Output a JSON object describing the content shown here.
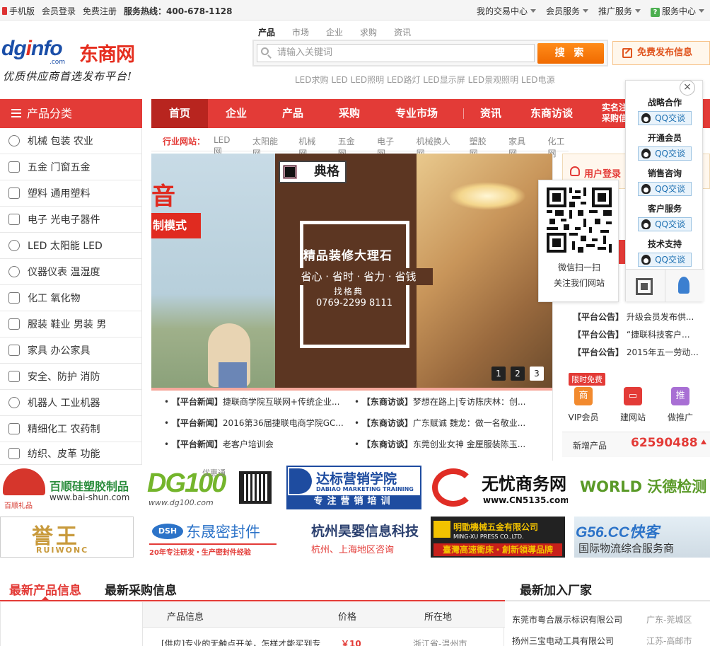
{
  "topbar": {
    "mobile": "手机版",
    "login": "会员登录",
    "register": "免费注册",
    "hotline": "服务热线：400-678-1128",
    "trade_center": "我的交易中心",
    "member_service": "会员服务",
    "promo_service": "推广服务",
    "service_center": "服务中心"
  },
  "logo": {
    "en": "dginfo",
    "cn": "东商网",
    "com": ".com",
    "slogan": "优质供应商首选发布平台!"
  },
  "search": {
    "tabs": [
      "产品",
      "市场",
      "企业",
      "求购",
      "资讯"
    ],
    "placeholder": "请输入关键词",
    "button": "搜 索",
    "publish": "免费发布信息",
    "hotwords": "LED求购 LED LED照明 LED路灯 LED显示屏 LED景观照明 LED电源"
  },
  "category_header": "产品分类",
  "categories": [
    {
      "label": "机械  包装  农业",
      "icon": "gear-icon"
    },
    {
      "label": "五金  门窗五金",
      "icon": "hardware-icon"
    },
    {
      "label": "塑料  通用塑料",
      "icon": "sliders-icon"
    },
    {
      "label": "电子  光电子器件",
      "icon": "tv-icon"
    },
    {
      "label": "LED  太阳能  LED",
      "icon": "bulb-icon"
    },
    {
      "label": "仪器仪表  温湿度",
      "icon": "gauge-icon"
    },
    {
      "label": "化工  氧化物",
      "icon": "flask-icon"
    },
    {
      "label": "服装  鞋业  男装  男",
      "icon": "shirt-icon"
    },
    {
      "label": "家具  办公家具",
      "icon": "sofa-icon"
    },
    {
      "label": "安全、防护  消防",
      "icon": "monitor-icon"
    },
    {
      "label": "机器人  工业机器",
      "icon": "robot-icon"
    },
    {
      "label": "精细化工  农药制",
      "icon": "gift-icon"
    },
    {
      "label": "纺织、皮革  功能",
      "icon": "bag-icon"
    }
  ],
  "nav": {
    "items": [
      "首页",
      "企业",
      "产品",
      "采购",
      "专业市场",
      "资讯",
      "东商访谈"
    ],
    "extra": "实名注\n采购信"
  },
  "industry": {
    "label": "行业网站：",
    "links": [
      "LED网",
      "太阳能网",
      "机械网",
      "五金网",
      "电子网",
      "机械换人网",
      "塑胶网",
      "家具网",
      "化工网"
    ]
  },
  "banner": {
    "red_big": "音",
    "red_tag": "制模式",
    "brand": "典格",
    "slogan1": "精品装修大理石",
    "slogan2": "省心 · 省时 · 省力 · 省钱",
    "find": "找格典",
    "tel": "0769-2299 8111",
    "pages": [
      "1",
      "2",
      "3"
    ],
    "active_page": 3
  },
  "news": [
    {
      "tag": "【平台新闻】",
      "title": "捷联商学院互联网+传统企业..."
    },
    {
      "tag": "【东商访谈】",
      "title": "梦想在路上|专访陈庆林：创..."
    },
    {
      "tag": "【平台新闻】",
      "title": "2016第36届捷联电商学院GC..."
    },
    {
      "tag": "【东商访谈】",
      "title": "广东赋诚 魏龙：做一名敬业..."
    },
    {
      "tag": "【平台新闻】",
      "title": "老客户培训会"
    },
    {
      "tag": "【东商访谈】",
      "title": "东莞创业女神 金厘服装陈玉..."
    }
  ],
  "sidebar": {
    "login": "用户登录",
    "notices": [
      {
        "tag": "【平台公告】",
        "title": "升级会员发布供..."
      },
      {
        "tag": "【平台公告】",
        "title": "“捷联科技客户..."
      },
      {
        "tag": "【平台公告】",
        "title": "2015年五一劳动..."
      }
    ],
    "limit_free": "限时免费",
    "services": [
      {
        "label": "VIP会员",
        "icon": "shop-icon",
        "glyph": "商",
        "color": "#f28a2e"
      },
      {
        "label": "建网站",
        "icon": "laptop-icon",
        "glyph": "▭",
        "color": "#e33b37"
      },
      {
        "label": "做推广",
        "icon": "promote-icon",
        "glyph": "推",
        "color": "#a86fd4"
      }
    ],
    "new_products_label": "新增产品",
    "new_products_count": "62590488"
  },
  "qr_popup": {
    "line1": "微信扫一扫",
    "line2": "关注我们网站"
  },
  "qq_panel": {
    "close": "×",
    "groups": [
      {
        "title": "战略合作",
        "button": "QQ交谈"
      },
      {
        "title": "开通会员",
        "button": "QQ交谈"
      },
      {
        "title": "销售咨询",
        "button": "QQ交谈"
      },
      {
        "title": "客户服务",
        "button": "QQ交谈"
      },
      {
        "title": "技术支持",
        "button": "QQ交谈"
      }
    ]
  },
  "ads": [
    {
      "name": "ad-baishun",
      "text": "百顺硅塑胶制品",
      "sub": "www.bai-shun.com",
      "sub2": "百顺礼品"
    },
    {
      "name": "ad-dg100",
      "text": "DG100",
      "sub": "www.dg100.com",
      "badge": "优惠通"
    },
    {
      "name": "ad-dabiao",
      "text": "达标营销学院",
      "sub": "DABIAO MARKETING TRAINING",
      "sub2": "专注营销培训"
    },
    {
      "name": "ad-cn5135",
      "text": "无忧商务网",
      "sub": "www.CN5135.com"
    },
    {
      "name": "ad-world",
      "text": "WORLD 沃德检测"
    },
    {
      "name": "ad-yuwang",
      "text": "誉王",
      "sub": "RUIWONC"
    },
    {
      "name": "ad-dsh",
      "text": "东晟密封件",
      "sub": "20年专注研发・生产密封件经验",
      "badge": "DSH"
    },
    {
      "name": "ad-haoying",
      "text": "杭州昊婴信息科技",
      "sub": "杭州、上海地区咨询"
    },
    {
      "name": "ad-mingxu",
      "text": "明勖機械五金有限公司",
      "sub": "MING-XU PRESS CO.,LTD.",
      "sub2": "臺灣高速衝床・創新領導品牌"
    },
    {
      "name": "ad-g56",
      "text": "G56.CC快客",
      "sub": "国际物流综合服务商"
    }
  ],
  "bottom": {
    "tabs": [
      "最新产品信息",
      "最新采购信息"
    ],
    "factory_title": "最新加入厂家",
    "table_headers": [
      "产品信息",
      "价格",
      "所在地"
    ],
    "row": {
      "title": "[供应]专业的无触点开关，怎样才能买到专",
      "price": "￥10",
      "location": "浙江省-温州市"
    },
    "factories": [
      {
        "name": "东莞市粤合展示标识有限公司",
        "loc": "广东-莞城区"
      },
      {
        "name": "扬州三宝电动工具有限公司",
        "loc": "江苏-高邮市"
      }
    ]
  },
  "colors": {
    "brand_red": "#e33b37",
    "orange": "#f06a00",
    "blue": "#1a4ea8"
  }
}
